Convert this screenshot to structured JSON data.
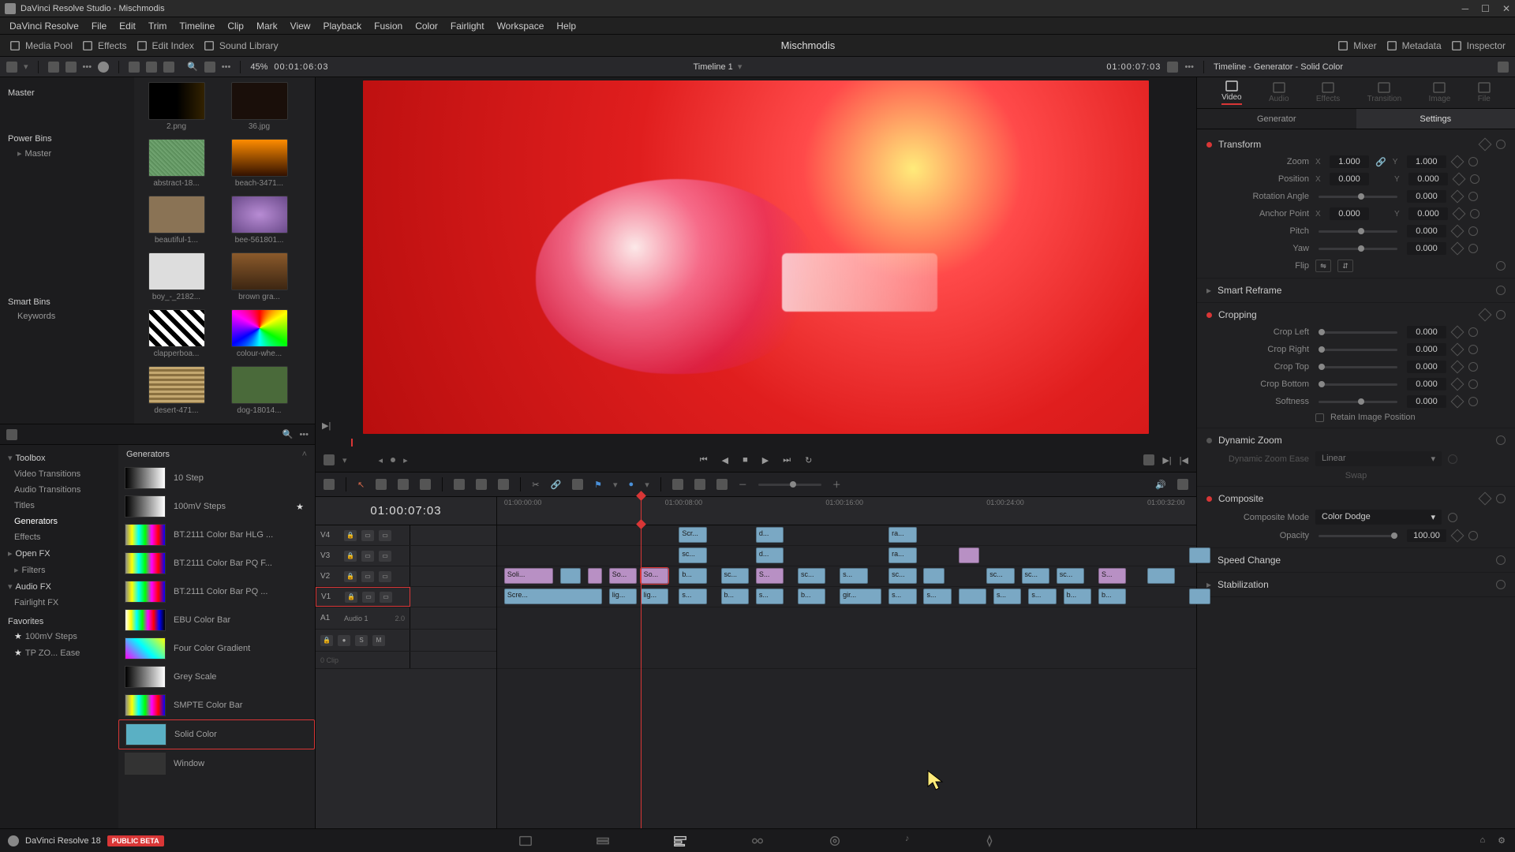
{
  "app": {
    "title": "DaVinci Resolve Studio - Mischmodis"
  },
  "menubar": [
    "DaVinci Resolve",
    "File",
    "Edit",
    "Trim",
    "Timeline",
    "Clip",
    "Mark",
    "View",
    "Playback",
    "Fusion",
    "Color",
    "Fairlight",
    "Workspace",
    "Help"
  ],
  "toptoolbar": {
    "left": [
      {
        "icon": "media-pool-icon",
        "label": "Media Pool"
      },
      {
        "icon": "effects-icon",
        "label": "Effects"
      },
      {
        "icon": "edit-index-icon",
        "label": "Edit Index"
      },
      {
        "icon": "sound-library-icon",
        "label": "Sound Library"
      }
    ],
    "center": "Mischmodis",
    "right": [
      {
        "icon": "mixer-icon",
        "label": "Mixer"
      },
      {
        "icon": "metadata-icon",
        "label": "Metadata"
      },
      {
        "icon": "inspector-icon",
        "label": "Inspector"
      }
    ]
  },
  "subtoolbar": {
    "zoom_percent": "45%",
    "source_tc": "00:01:06:03",
    "timeline_name": "Timeline 1",
    "record_tc": "01:00:07:03",
    "inspector_title": "Timeline - Generator - Solid Color"
  },
  "bins": {
    "master": "Master",
    "power_bins": "Power Bins",
    "power_master": "Master",
    "smart_bins": "Smart Bins",
    "keywords": "Keywords"
  },
  "thumbs": [
    {
      "label": "2.png",
      "bg": "linear-gradient(90deg,#000 50%,#332200)"
    },
    {
      "label": "36.jpg",
      "bg": "#1a0f0a"
    },
    {
      "label": "abstract-18...",
      "bg": "repeating-linear-gradient(45deg,#7a7,#585 4px)"
    },
    {
      "label": "beach-3471...",
      "bg": "linear-gradient(#ff8c00,#331100)"
    },
    {
      "label": "beautiful-1...",
      "bg": "#8a7355"
    },
    {
      "label": "bee-561801...",
      "bg": "radial-gradient(#b88cd4,#6a4a8a)"
    },
    {
      "label": "boy_-_2182...",
      "bg": "#ddd"
    },
    {
      "label": "brown gra...",
      "bg": "linear-gradient(#8b5a2b,#3d2612)"
    },
    {
      "label": "clapperboa...",
      "bg": "repeating-linear-gradient(45deg,#fff 0 6px,#000 6px 12px)"
    },
    {
      "label": "colour-whe...",
      "bg": "conic-gradient(red,yellow,lime,cyan,blue,magenta,red)"
    },
    {
      "label": "desert-471...",
      "bg": "repeating-linear-gradient(#c4a870 0 3px,#8a7040 3px 6px)"
    },
    {
      "label": "dog-18014...",
      "bg": "#4a6a3a"
    }
  ],
  "fx_nav": {
    "toolbox": "Toolbox",
    "items": [
      "Video Transitions",
      "Audio Transitions",
      "Titles",
      "Generators",
      "Effects"
    ],
    "active_index": 3,
    "openfx": "Open FX",
    "filters": "Filters",
    "audiofx": "Audio FX",
    "fairlightfx": "Fairlight FX",
    "favorites": "Favorites",
    "fav_items": [
      "100mV Steps",
      "TP ZO... Ease"
    ]
  },
  "fx_list": {
    "title": "Generators",
    "items": [
      {
        "label": "10 Step",
        "swatch": "linear-gradient(90deg,#000,#fff)"
      },
      {
        "label": "100mV Steps",
        "swatch": "linear-gradient(90deg,#000,#fff)",
        "starred": true
      },
      {
        "label": "BT.2111 Color Bar HLG ...",
        "swatch": "linear-gradient(90deg,#888,#ff0,#0ff,#0f0,#f0f,#f00,#00f)"
      },
      {
        "label": "BT.2111 Color Bar PQ F...",
        "swatch": "linear-gradient(90deg,#888,#ff0,#0ff,#0f0,#f0f,#f00,#00f)"
      },
      {
        "label": "BT.2111 Color Bar PQ ...",
        "swatch": "linear-gradient(90deg,#888,#ff0,#0ff,#0f0,#f0f,#f00,#00f)"
      },
      {
        "label": "EBU Color Bar",
        "swatch": "linear-gradient(90deg,#fff,#ff0,#0ff,#0f0,#f0f,#f00,#00f,#000)"
      },
      {
        "label": "Four Color Gradient",
        "swatch": "linear-gradient(45deg,#f0f,#0ff,#ff0)"
      },
      {
        "label": "Grey Scale",
        "swatch": "linear-gradient(90deg,#000,#fff)"
      },
      {
        "label": "SMPTE Color Bar",
        "swatch": "linear-gradient(90deg,#888,#ff0,#0ff,#0f0,#f0f,#f00,#00f)"
      },
      {
        "label": "Solid Color",
        "swatch": "#5ab0c4",
        "selected": true
      },
      {
        "label": "Window",
        "swatch": "#333"
      }
    ]
  },
  "timeline": {
    "tc": "01:00:07:03",
    "ruler": [
      "01:00:00:00",
      "01:00:08:00",
      "01:00:16:00",
      "01:00:24:00",
      "01:00:32:00"
    ],
    "tracks": [
      {
        "name": "V4",
        "clips": [
          {
            "l": 26,
            "w": 4,
            "t": "Scr...",
            "c": "blue"
          },
          {
            "l": 37,
            "w": 4,
            "t": "d...",
            "c": "blue"
          },
          {
            "l": 56,
            "w": 4,
            "t": "ra...",
            "c": "blue"
          }
        ]
      },
      {
        "name": "V3",
        "clips": [
          {
            "l": 26,
            "w": 4,
            "t": "sc...",
            "c": "blue"
          },
          {
            "l": 37,
            "w": 4,
            "t": "d...",
            "c": "blue"
          },
          {
            "l": 56,
            "w": 4,
            "t": "ra...",
            "c": "blue"
          },
          {
            "l": 66,
            "w": 3,
            "t": "",
            "c": "purple"
          },
          {
            "l": 99,
            "w": 3,
            "t": "",
            "c": "blue"
          }
        ]
      },
      {
        "name": "V2",
        "clips": [
          {
            "l": 1,
            "w": 7,
            "t": "Soli...",
            "c": "purple"
          },
          {
            "l": 9,
            "w": 3,
            "t": "",
            "c": "blue"
          },
          {
            "l": 13,
            "w": 2,
            "t": "",
            "c": "purple"
          },
          {
            "l": 16,
            "w": 4,
            "t": "So...",
            "c": "purple"
          },
          {
            "l": 20.5,
            "w": 4,
            "t": "So...",
            "c": "purple",
            "sel": true
          },
          {
            "l": 26,
            "w": 4,
            "t": "b...",
            "c": "blue"
          },
          {
            "l": 32,
            "w": 4,
            "t": "sc...",
            "c": "blue"
          },
          {
            "l": 37,
            "w": 4,
            "t": "S...",
            "c": "purple"
          },
          {
            "l": 43,
            "w": 4,
            "t": "sc...",
            "c": "blue"
          },
          {
            "l": 49,
            "w": 4,
            "t": "s...",
            "c": "blue"
          },
          {
            "l": 56,
            "w": 4,
            "t": "sc...",
            "c": "blue"
          },
          {
            "l": 61,
            "w": 3,
            "t": "",
            "c": "blue"
          },
          {
            "l": 70,
            "w": 4,
            "t": "sc...",
            "c": "blue"
          },
          {
            "l": 75,
            "w": 4,
            "t": "sc...",
            "c": "blue"
          },
          {
            "l": 80,
            "w": 4,
            "t": "sc...",
            "c": "blue"
          },
          {
            "l": 86,
            "w": 4,
            "t": "S...",
            "c": "purple"
          },
          {
            "l": 93,
            "w": 4,
            "t": "",
            "c": "blue"
          }
        ]
      },
      {
        "name": "V1",
        "selected": true,
        "clips": [
          {
            "l": 1,
            "w": 14,
            "t": "Scre...",
            "c": "blue"
          },
          {
            "l": 16,
            "w": 4,
            "t": "lig...",
            "c": "blue"
          },
          {
            "l": 20.5,
            "w": 4,
            "t": "lig...",
            "c": "blue"
          },
          {
            "l": 26,
            "w": 4,
            "t": "s...",
            "c": "blue"
          },
          {
            "l": 32,
            "w": 4,
            "t": "b...",
            "c": "blue"
          },
          {
            "l": 37,
            "w": 4,
            "t": "s...",
            "c": "blue"
          },
          {
            "l": 43,
            "w": 4,
            "t": "b...",
            "c": "blue"
          },
          {
            "l": 49,
            "w": 6,
            "t": "gir...",
            "c": "blue"
          },
          {
            "l": 56,
            "w": 4,
            "t": "s...",
            "c": "blue"
          },
          {
            "l": 61,
            "w": 4,
            "t": "s...",
            "c": "blue"
          },
          {
            "l": 66,
            "w": 4,
            "t": "",
            "c": "blue"
          },
          {
            "l": 71,
            "w": 4,
            "t": "s...",
            "c": "blue"
          },
          {
            "l": 76,
            "w": 4,
            "t": "s...",
            "c": "blue"
          },
          {
            "l": 81,
            "w": 4,
            "t": "b...",
            "c": "blue"
          },
          {
            "l": 86,
            "w": 4,
            "t": "b...",
            "c": "blue"
          },
          {
            "l": 99,
            "w": 3,
            "t": "",
            "c": "blue"
          }
        ]
      }
    ],
    "audio_track": {
      "name": "A1",
      "label": "Audio 1",
      "ch": "2.0",
      "clip_hint": "0 Clip"
    }
  },
  "inspector": {
    "tabs": [
      "Video",
      "Audio",
      "Effects",
      "Transition",
      "Image",
      "File"
    ],
    "active_tab": 0,
    "subtabs": [
      "Generator",
      "Settings"
    ],
    "active_subtab": 1,
    "transform": {
      "title": "Transform",
      "zoom": {
        "label": "Zoom",
        "x": "1.000",
        "y": "1.000"
      },
      "position": {
        "label": "Position",
        "x": "0.000",
        "y": "0.000"
      },
      "rotation": {
        "label": "Rotation Angle",
        "val": "0.000"
      },
      "anchor": {
        "label": "Anchor Point",
        "x": "0.000",
        "y": "0.000"
      },
      "pitch": {
        "label": "Pitch",
        "val": "0.000"
      },
      "yaw": {
        "label": "Yaw",
        "val": "0.000"
      },
      "flip": {
        "label": "Flip"
      }
    },
    "smart_reframe": {
      "title": "Smart Reframe"
    },
    "cropping": {
      "title": "Cropping",
      "left": {
        "label": "Crop Left",
        "val": "0.000"
      },
      "right": {
        "label": "Crop Right",
        "val": "0.000"
      },
      "top": {
        "label": "Crop Top",
        "val": "0.000"
      },
      "bottom": {
        "label": "Crop Bottom",
        "val": "0.000"
      },
      "softness": {
        "label": "Softness",
        "val": "0.000"
      },
      "retain": "Retain Image Position"
    },
    "dynamic_zoom": {
      "title": "Dynamic Zoom",
      "ease_label": "Dynamic Zoom Ease",
      "ease_val": "Linear",
      "swap": "Swap"
    },
    "composite": {
      "title": "Composite",
      "mode_label": "Composite Mode",
      "mode_val": "Color Dodge",
      "opacity_label": "Opacity",
      "opacity_val": "100.00"
    },
    "speed_change": {
      "title": "Speed Change"
    },
    "stabilization": {
      "title": "Stabilization"
    }
  },
  "pagebar": {
    "app_label": "DaVinci Resolve 18",
    "badge": "PUBLIC BETA"
  }
}
